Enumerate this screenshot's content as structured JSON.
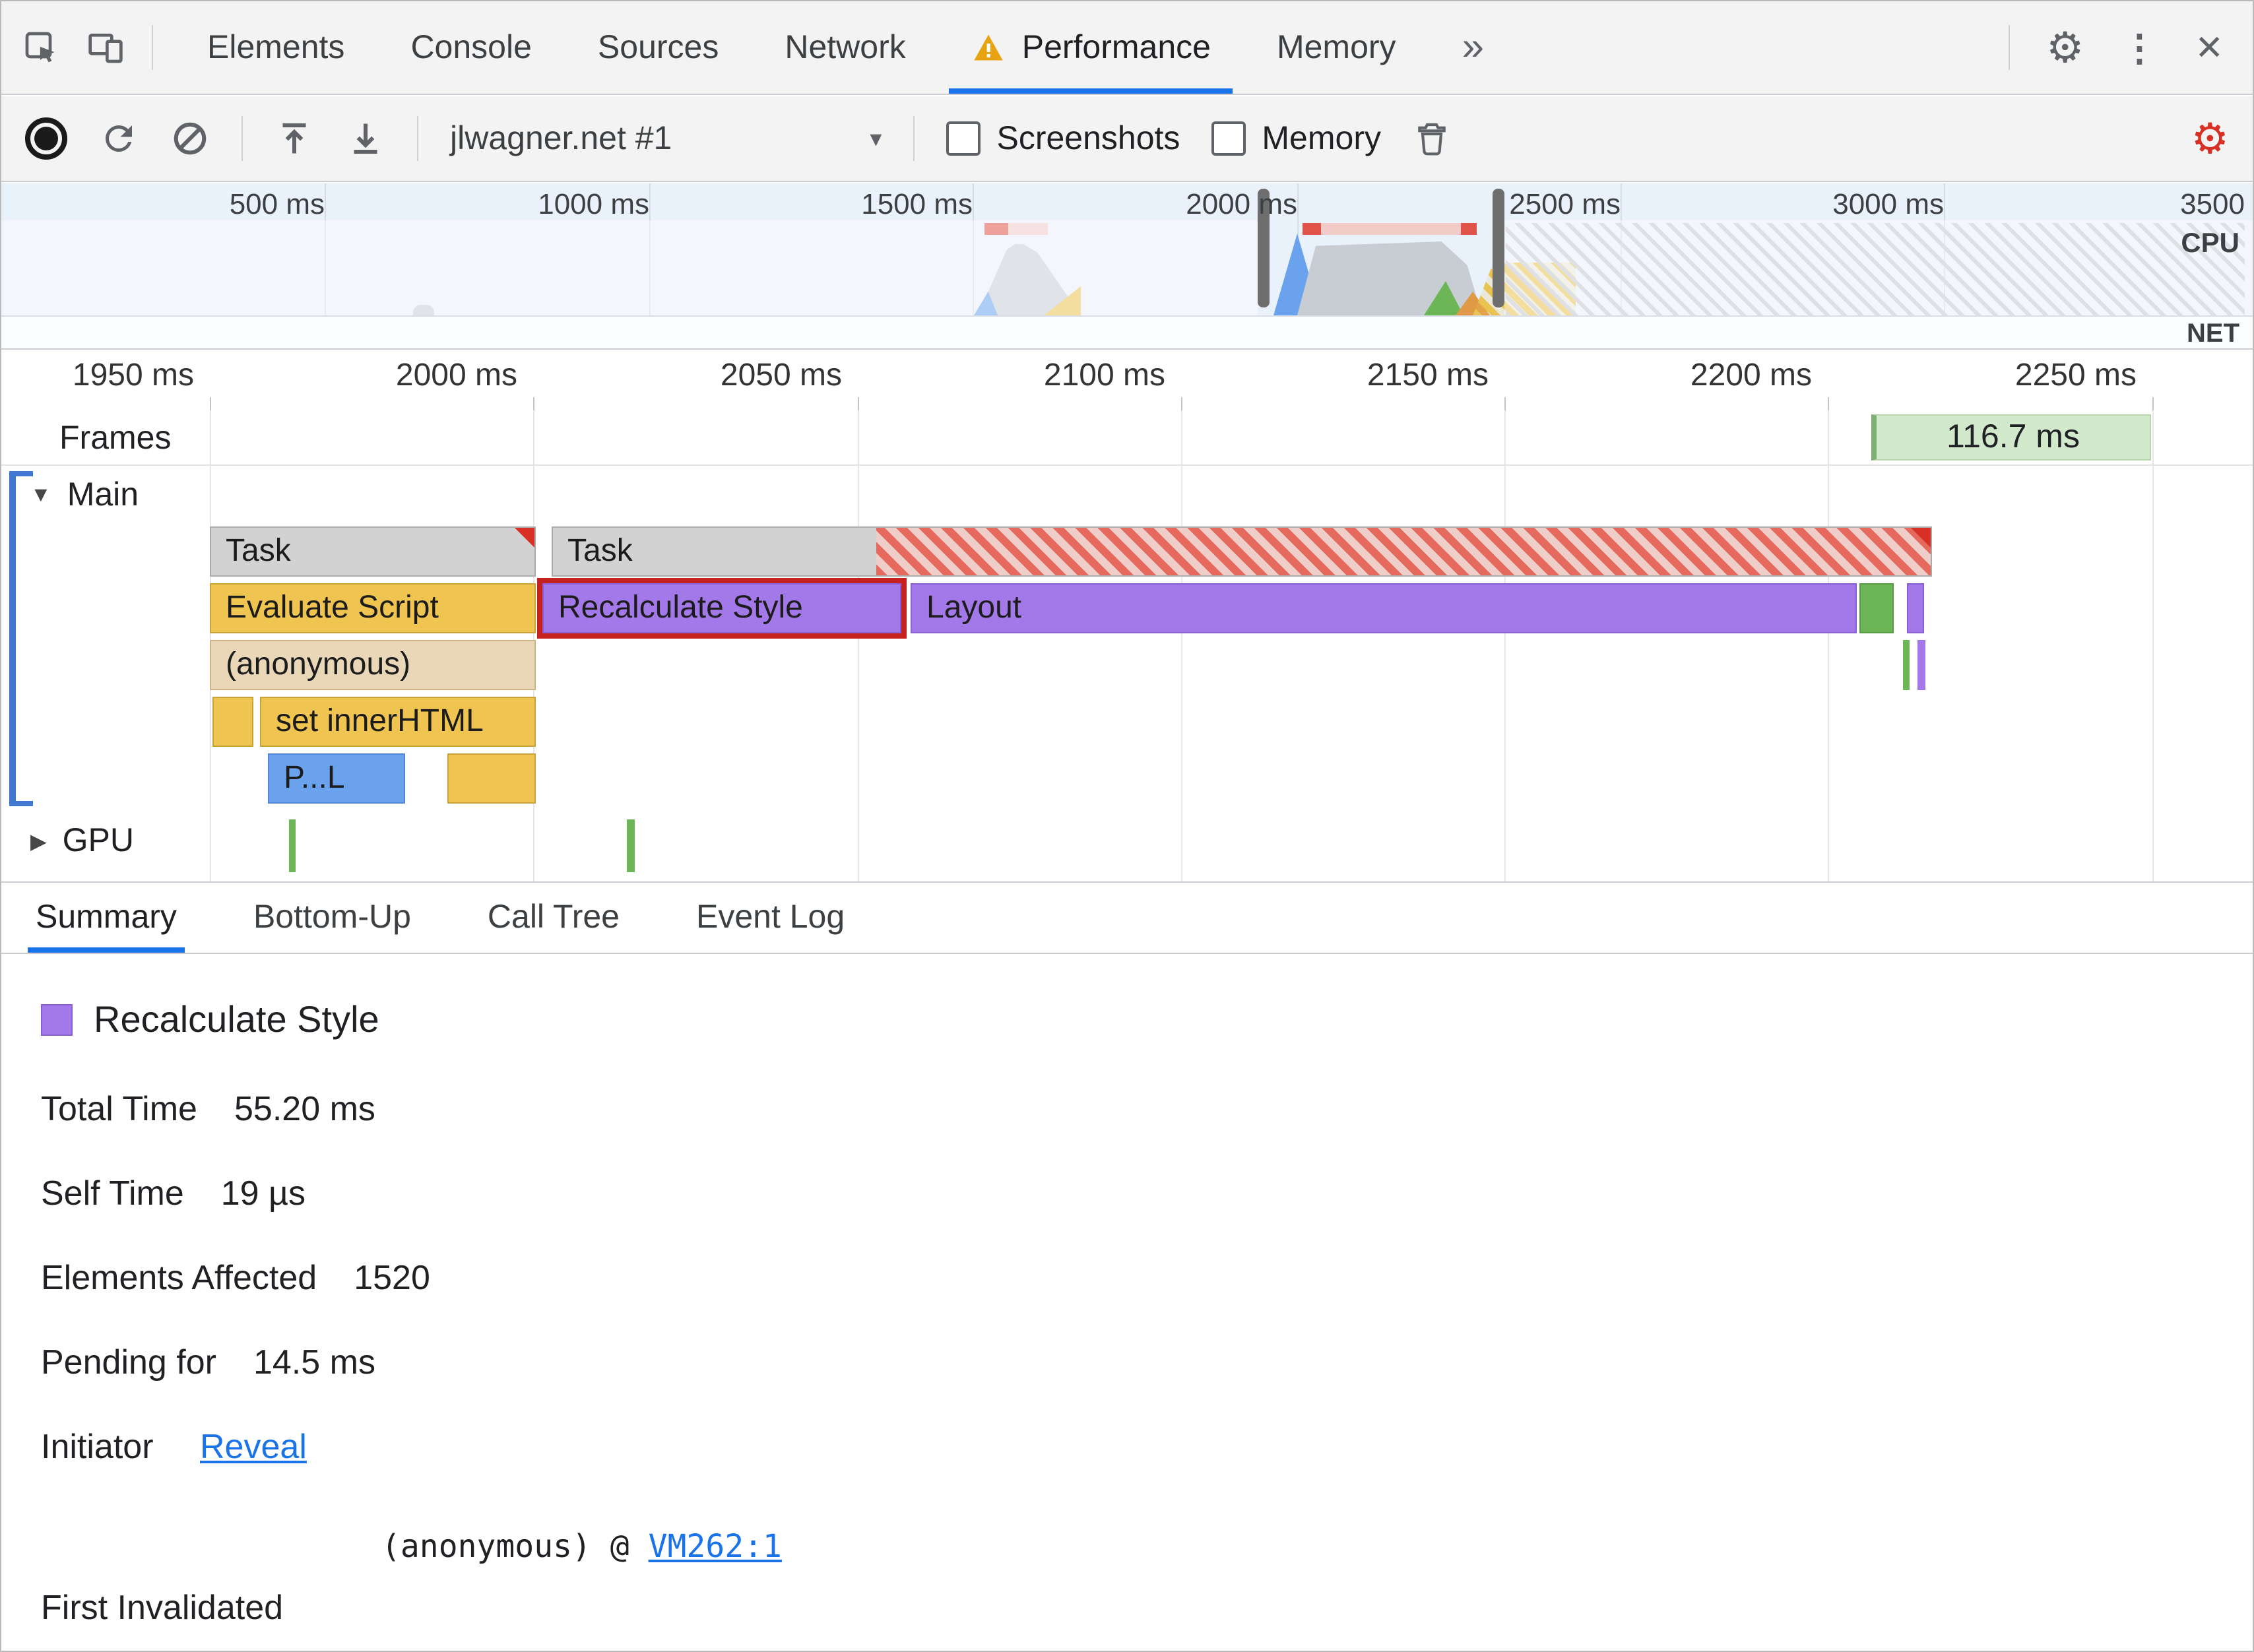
{
  "tab_bar": {
    "tabs": [
      {
        "label": "Elements"
      },
      {
        "label": "Console"
      },
      {
        "label": "Sources"
      },
      {
        "label": "Network"
      },
      {
        "label": "Performance",
        "active": true,
        "has_warning": true
      },
      {
        "label": "Memory"
      }
    ],
    "overflow_glyph": "»"
  },
  "icons": {
    "gear": "⚙",
    "kebab": "⋮",
    "close": "✕",
    "dropdown_arrow": "▾",
    "expanded": "▼",
    "collapsed": "▶"
  },
  "toolbar": {
    "history_dropdown": "jlwagner.net #1",
    "screenshots_label": "Screenshots",
    "memory_label": "Memory"
  },
  "overview": {
    "ruler_ticks": [
      "500 ms",
      "1000 ms",
      "1500 ms",
      "2000 ms",
      "2500 ms",
      "3000 ms",
      "3500"
    ],
    "cpu_label": "CPU",
    "net_label": "NET"
  },
  "timeline": {
    "ruler_ticks": [
      "1950 ms",
      "2000 ms",
      "2050 ms",
      "2100 ms",
      "2150 ms",
      "2200 ms",
      "2250 ms"
    ],
    "frames_label": "Frames",
    "frame_duration": "116.7 ms",
    "main_track": "Main",
    "gpu_track": "GPU",
    "bars": {
      "task1": "Task",
      "task2": "Task",
      "evaluate_script": "Evaluate Script",
      "recalculate_style": "Recalculate Style",
      "layout": "Layout",
      "anonymous": "(anonymous)",
      "set_inner_html": "set innerHTML",
      "parse_html": "P...L"
    }
  },
  "bottom_tabs": [
    {
      "label": "Summary",
      "active": true
    },
    {
      "label": "Bottom-Up"
    },
    {
      "label": "Call Tree"
    },
    {
      "label": "Event Log"
    }
  ],
  "summary": {
    "title": "Recalculate Style",
    "stats": [
      {
        "label": "Total Time",
        "value": "55.20 ms"
      },
      {
        "label": "Self Time",
        "value": "19 µs"
      },
      {
        "label": "Elements Affected",
        "value": "1520"
      },
      {
        "label": "Pending for",
        "value": "14.5 ms"
      }
    ],
    "initiator": {
      "label": "Initiator",
      "link": "Reveal"
    },
    "first_invalidated": {
      "label": "First Invalidated",
      "code": "(anonymous) @ ",
      "link": "VM262:1"
    }
  },
  "colors": {
    "accent_blue": "#1a73e8",
    "selection_red": "#c5221f",
    "scripting_yellow": "#efc450",
    "rendering_purple": "#a379e9",
    "painting_green": "#6db657",
    "task_gray": "#d2d2d2",
    "long_task_red": "#e5695c",
    "frame_badge_green": "#d2e9cc",
    "warning_orange": "#e8a312",
    "record_gear_red": "#d93025"
  }
}
